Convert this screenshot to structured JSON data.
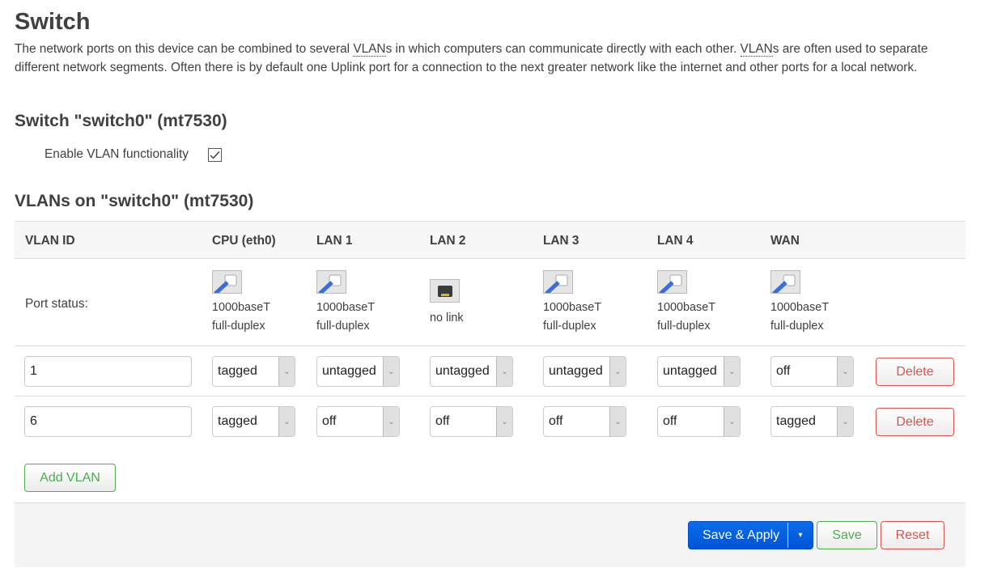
{
  "page": {
    "title": "Switch",
    "description_parts": [
      "The network ports on this device can be combined to several ",
      "VLAN",
      "s in which computers can communicate directly with each other. ",
      "VLAN",
      "s are often used to separate different network segments. Often there is by default one Uplink port for a connection to the next greater network like the internet and other ports for a local network."
    ]
  },
  "switch_section": {
    "heading": "Switch \"switch0\" (mt7530)",
    "enable_vlan_label": "Enable VLAN functionality",
    "enable_vlan_checked": true
  },
  "vlans_section": {
    "heading": "VLANs on \"switch0\" (mt7530)",
    "columns": [
      "VLAN ID",
      "CPU (eth0)",
      "LAN 1",
      "LAN 2",
      "LAN 3",
      "LAN 4",
      "WAN"
    ],
    "port_status_label": "Port status:",
    "ports": [
      {
        "icon": "port-up-icon",
        "speed": "1000baseT",
        "duplex": "full-duplex"
      },
      {
        "icon": "port-up-icon",
        "speed": "1000baseT",
        "duplex": "full-duplex"
      },
      {
        "icon": "port-down-icon",
        "speed": "no link",
        "duplex": ""
      },
      {
        "icon": "port-up-icon",
        "speed": "1000baseT",
        "duplex": "full-duplex"
      },
      {
        "icon": "port-up-icon",
        "speed": "1000baseT",
        "duplex": "full-duplex"
      },
      {
        "icon": "port-up-icon",
        "speed": "1000baseT",
        "duplex": "full-duplex"
      }
    ],
    "rows": [
      {
        "vlan_id": "1",
        "values": [
          "tagged",
          "untagged",
          "untagged",
          "untagged",
          "untagged",
          "off"
        ],
        "delete_label": "Delete"
      },
      {
        "vlan_id": "6",
        "values": [
          "tagged",
          "off",
          "off",
          "off",
          "off",
          "tagged"
        ],
        "delete_label": "Delete"
      }
    ],
    "add_label": "Add VLAN"
  },
  "footer": {
    "save_apply_label": "Save & Apply",
    "dropdown_glyph": "▾",
    "save_label": "Save",
    "reset_label": "Reset"
  },
  "colors": {
    "primary": "#0a6ce8",
    "positive": "#4cae4c",
    "negative": "#d9534f"
  }
}
